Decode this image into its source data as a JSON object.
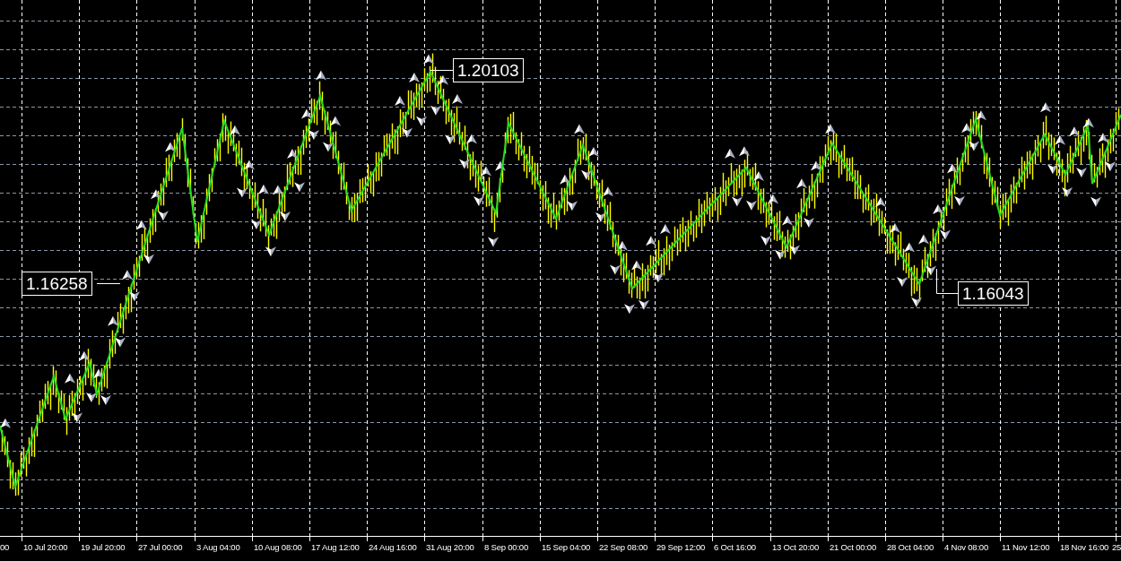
{
  "chart": {
    "price_labels": [
      {
        "text": "1.16258"
      },
      {
        "text": "1.20103"
      },
      {
        "text": "1.16043"
      }
    ],
    "time_axis": {
      "labels": [
        "00",
        "10 Jul 20:00",
        "19 Jul 20:00",
        "27 Jul 00:00",
        "3 Aug 04:00",
        "10 Aug 08:00",
        "17 Aug 12:00",
        "24 Aug 16:00",
        "31 Aug 20:00",
        "8 Sep 00:00",
        "15 Sep 04:00",
        "22 Sep 08:00",
        "29 Sep 12:00",
        "6 Oct 16:00",
        "13 Oct 20:00",
        "21 Oct 00:00",
        "28 Oct 04:00",
        "4 Nov 08:00",
        "11 Nov 12:00",
        "18 Nov 16:00",
        "25"
      ]
    }
  }
}
